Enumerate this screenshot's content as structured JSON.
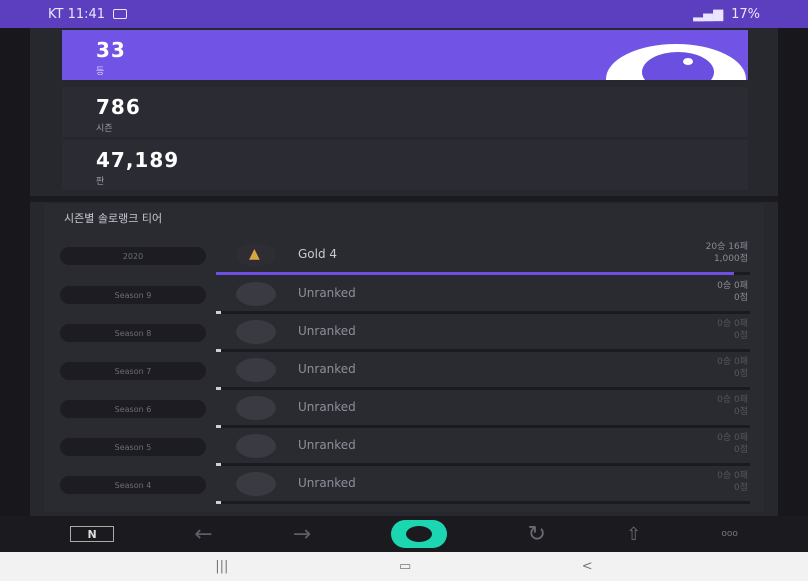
{
  "status_bar": {
    "left_text": "KT 11:41",
    "right_text": "17%"
  },
  "stats": [
    {
      "value": "33",
      "label": "등"
    },
    {
      "value": "786",
      "label": "시즌"
    },
    {
      "value": "47,189",
      "label": "판"
    }
  ],
  "section_title": "시즌별 솔로랭크 티어",
  "seasons": [
    {
      "season": "2020",
      "tier": "Gold 4",
      "line1": "20승 16패",
      "line2": "1,000점",
      "progress": 0.97
    },
    {
      "season": "Season 9",
      "tier": "Unranked",
      "line1": "0승 0패",
      "line2": "0점",
      "progress": 0.01
    },
    {
      "season": "Season 8",
      "tier": "Unranked",
      "line1": "0승 0패",
      "line2": "0점",
      "progress": 0.01
    },
    {
      "season": "Season 7",
      "tier": "Unranked",
      "line1": "0승 0패",
      "line2": "0점",
      "progress": 0.01
    },
    {
      "season": "Season 6",
      "tier": "Unranked",
      "line1": "0승 0패",
      "line2": "0점",
      "progress": 0.01
    },
    {
      "season": "Season 5",
      "tier": "Unranked",
      "line1": "0승 0패",
      "line2": "0점",
      "progress": 0.01
    },
    {
      "season": "Season 4",
      "tier": "Unranked",
      "line1": "0승 0패",
      "line2": "0점",
      "progress": 0.01
    }
  ],
  "nav": {
    "n_label": "N",
    "back_icon": "arrow-left-icon",
    "forward_icon": "arrow-right-icon",
    "home_icon": "home-ring-icon",
    "refresh_icon": "refresh-icon",
    "share_icon": "share-icon",
    "more_label": "ooo"
  },
  "system_bar": {
    "recents_glyph": "|||",
    "home_glyph": "▭",
    "back_glyph": "<"
  },
  "colors": {
    "accent": "#7154e6",
    "status_bar": "#5b3fbf",
    "gold": "#d9a441",
    "home_button": "#1bd6b0"
  }
}
